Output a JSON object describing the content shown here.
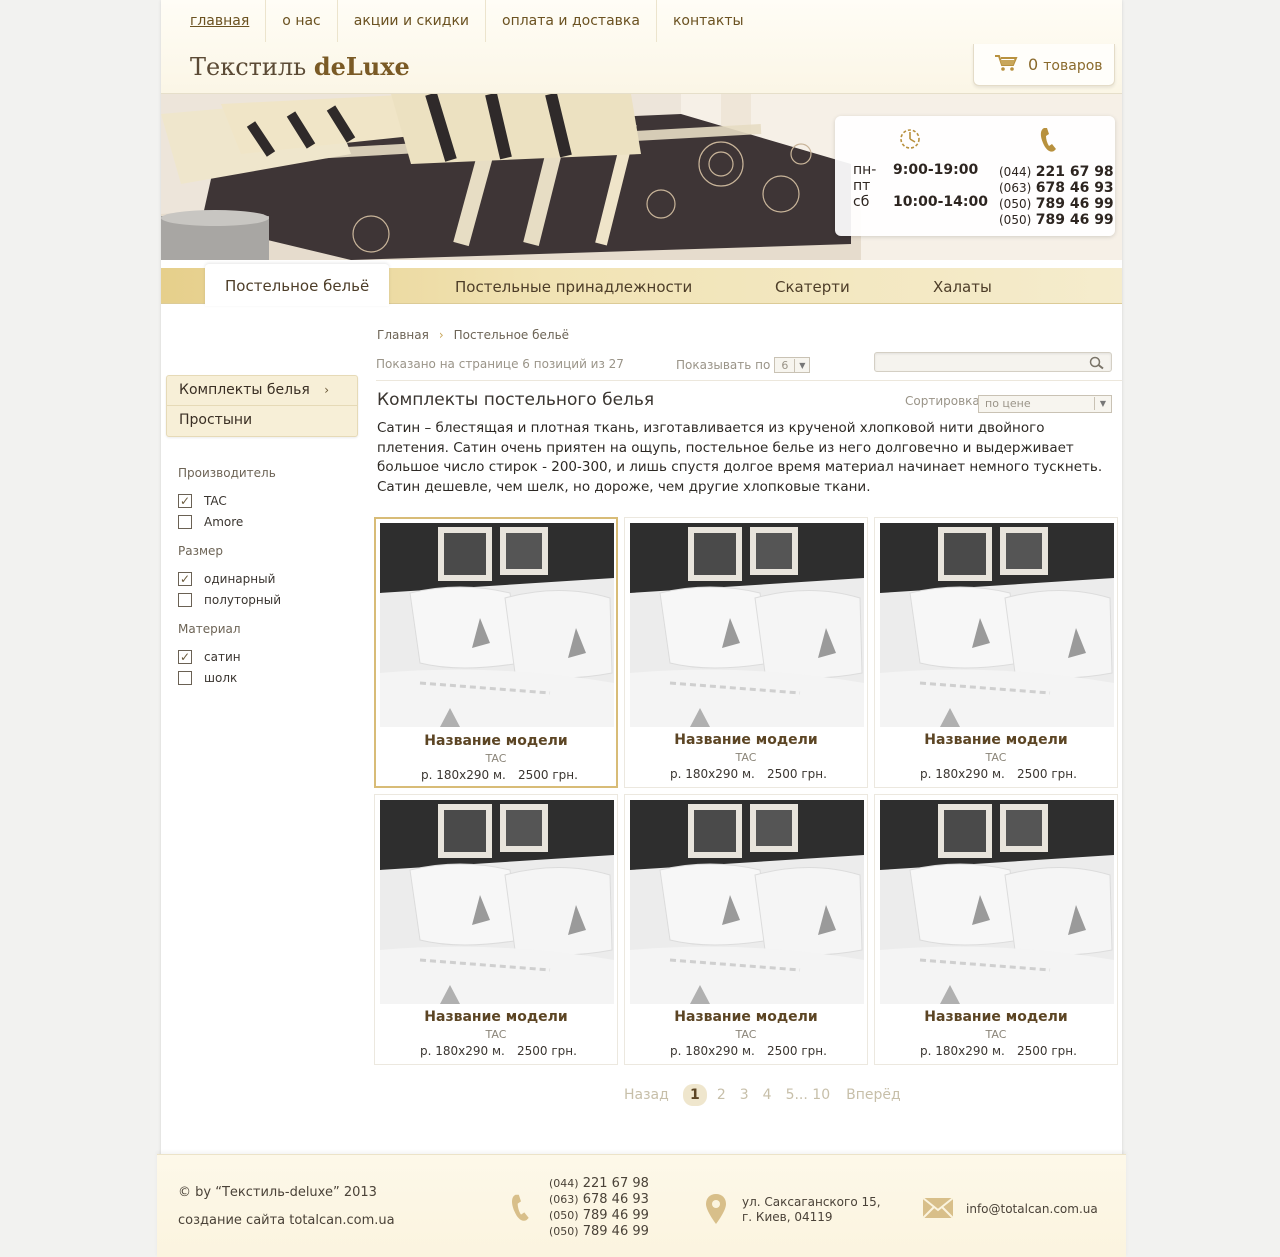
{
  "nav": {
    "items": [
      "главная",
      "о нас",
      "акции и скидки",
      "оплата и доставка",
      "контакты"
    ]
  },
  "logo": {
    "part1": "Текстиль ",
    "part2": "deLuxe"
  },
  "cart": {
    "count": "0",
    "label": "товаров",
    "icon": "cart-icon"
  },
  "contacts": {
    "hours": [
      {
        "days": "пн-пт",
        "time": "9:00-19:00"
      },
      {
        "days": "сб",
        "time": "10:00-14:00"
      }
    ],
    "phones": [
      {
        "code": "(044)",
        "number": "221 67 98"
      },
      {
        "code": "(063)",
        "number": "678 46 93"
      },
      {
        "code": "(050)",
        "number": "789 46 99"
      },
      {
        "code": "(050)",
        "number": "789 46 99"
      }
    ]
  },
  "categories": [
    "Постельное бельё",
    "Постельные принадлежности",
    "Скатерти",
    "Халаты"
  ],
  "sidebar": {
    "menu": [
      {
        "label": "Комплекты белья",
        "arrow": "›"
      },
      {
        "label": "Простыни"
      }
    ],
    "filters": [
      {
        "title": "Производитель",
        "options": [
          {
            "label": "TAC",
            "checked": true
          },
          {
            "label": "Amore",
            "checked": false
          }
        ]
      },
      {
        "title": "Размер",
        "options": [
          {
            "label": "одинарный",
            "checked": true
          },
          {
            "label": "полуторный",
            "checked": false
          }
        ]
      },
      {
        "title": "Материал",
        "options": [
          {
            "label": "сатин",
            "checked": true
          },
          {
            "label": "шолк",
            "checked": false
          }
        ]
      }
    ]
  },
  "breadcrumbs": {
    "home": "Главная",
    "sep": "›",
    "current": "Постельное бельё"
  },
  "listing": {
    "shown": "Показано на странице 6 позиций из 27",
    "perpage_label": "Показывать по",
    "perpage_value": "6",
    "search_placeholder": "",
    "title": "Комплекты постельного белья",
    "sort_label": "Сортировка",
    "sort_value": "по цене",
    "description": "Сатин – блестящая и плотная ткань, изготавливается из крученой хлопковой нити двойного плетения. Сатин очень приятен на ощупь, постельное белье из него долговечно и выдерживает большое число стирок - 200-300, и лишь спустя долгое время материал начинает немного тускнеть. Сатин дешевле, чем шелк, но дороже, чем другие хлопковые ткани."
  },
  "products": [
    {
      "name": "Название модели",
      "brand": "TAC",
      "size": "р. 180x290 м.",
      "price": "2500 грн."
    },
    {
      "name": "Название модели",
      "brand": "TAC",
      "size": "р. 180x290 м.",
      "price": "2500 грн."
    },
    {
      "name": "Название модели",
      "brand": "TAC",
      "size": "р. 180x290 м.",
      "price": "2500 грн."
    },
    {
      "name": "Название модели",
      "brand": "TAC",
      "size": "р. 180x290 м.",
      "price": "2500 грн."
    },
    {
      "name": "Название модели",
      "brand": "TAC",
      "size": "р. 180x290 м.",
      "price": "2500 грн."
    },
    {
      "name": "Название модели",
      "brand": "TAC",
      "size": "р. 180x290 м.",
      "price": "2500 грн."
    }
  ],
  "pager": {
    "prev": "Назад",
    "pages": [
      "1",
      "2",
      "3",
      "4",
      "5... 10"
    ],
    "next": "Вперёд"
  },
  "footer": {
    "copyright": "© by “Текстиль-deluxe” 2013",
    "madeby": "создание сайта totalcan.com.ua",
    "phones": [
      {
        "code": "(044)",
        "number": "221 67 98"
      },
      {
        "code": "(063)",
        "number": "678 46 93"
      },
      {
        "code": "(050)",
        "number": "789 46 99"
      },
      {
        "code": "(050)",
        "number": "789 46 99"
      }
    ],
    "address_line1": "ул. Саксаганского 15,",
    "address_line2": "г. Киев, 04119",
    "email": "info@totalcan.com.ua"
  },
  "colors": {
    "accent": "#c8a65a",
    "brand_text": "#6b5221",
    "catbar": "#eedcA2"
  }
}
